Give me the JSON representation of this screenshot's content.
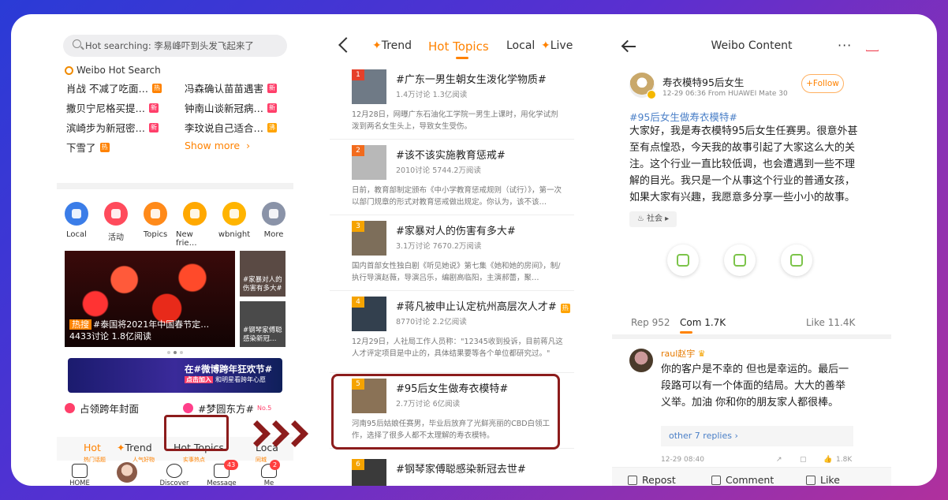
{
  "panel1": {
    "search_placeholder": "Hot searching: 李易峰吓到头发飞起来了",
    "hot_search_title": "Weibo Hot Search",
    "hot_items": [
      {
        "text": "肖战 不减了吃面…",
        "badge": "热"
      },
      {
        "text": "冯森确认苗苗遇害",
        "badge": "新"
      },
      {
        "text": "撒贝宁尼格买提…",
        "badge": "新"
      },
      {
        "text": "钟南山谈新冠病…",
        "badge": "新"
      },
      {
        "text": "滨崎步为新冠密…",
        "badge": "新"
      },
      {
        "text": "李玟说自己适合…",
        "badge": "沸"
      },
      {
        "text": "下雪了",
        "badge": "热"
      }
    ],
    "show_more": "Show more",
    "icons": [
      {
        "label": "Local",
        "color": "#3b7de8"
      },
      {
        "label": "活动",
        "color": "#ff4b5c"
      },
      {
        "label": "Topics",
        "color": "#ff8a1a"
      },
      {
        "label": "New frie…",
        "color": "#ffa800"
      },
      {
        "label": "wbnight",
        "color": "#ffb400"
      },
      {
        "label": "More",
        "color": "#8a93a8"
      }
    ],
    "banner_tag": "热搜",
    "banner_title": "#泰国将2021年中国春节定…",
    "banner_stats": "4433讨论 1.8亿阅读",
    "thumb1": "#家暴对人的伤害有多大#",
    "thumb2": "#钢琴家傅聪感染新冠…",
    "promo_title": "在#微博跨年狂欢节#",
    "promo_join": "点击加入",
    "promo_sub": "和明星看跨年心愿",
    "topic_a": "占领跨年封面",
    "topic_b": "#梦圆东方#",
    "topic_b_rank": "No.5",
    "tabs": [
      {
        "label": "Hot",
        "sub": "热门话题"
      },
      {
        "label": "Trend",
        "sub": "人气好物"
      },
      {
        "label": "Hot Topics",
        "sub": "实事热点"
      },
      {
        "label": "Loca",
        "sub": "同城"
      }
    ],
    "tabbar": [
      {
        "label": "HOME"
      },
      {
        "label": ""
      },
      {
        "label": "Discover"
      },
      {
        "label": "Message",
        "count": "43"
      },
      {
        "label": "Me",
        "count": "2"
      }
    ]
  },
  "panel2": {
    "nav": [
      "Trend",
      "Hot Topics",
      "Local",
      "Live"
    ],
    "topics": [
      {
        "rank": "1",
        "title": "#广东一男生朝女生泼化学物质#",
        "stats": "1.4万讨论 1.3亿阅读",
        "desc": "12月28日，网曝广东石油化工学院一男生上课时，用化学试剂泼到两名女生头上，导致女生受伤。"
      },
      {
        "rank": "2",
        "title": "#该不该实施教育惩戒#",
        "stats": "2010讨论 5744.2万阅读",
        "desc": "日前，教育部制定颁布《中小学教育惩戒规则（试行）》，第一次以部门规章的形式对教育惩戒做出规定。你认为，该不该…"
      },
      {
        "rank": "3",
        "title": "#家暴对人的伤害有多大#",
        "stats": "3.1万讨论 7670.2万阅读",
        "desc": "国内首部女性独白剧《听见她说》第七集《她和她的房间》，制/执行导演赵薇，导演吕乐，编剧高临阳，主演郝蕾，聚…"
      },
      {
        "rank": "4",
        "title": "#蒋凡被申止认定杭州高层次人才#",
        "stats": "8770讨论 2.2亿阅读",
        "desc": "12月29日，人社局工作人员称：\"12345收到投诉，目前蒋凡这人才评定项目是中止的，具体结果要等各个单位都研究过。\"",
        "badge": "热"
      },
      {
        "rank": "5",
        "title": "#95后女生做寿衣模特#",
        "stats": "2.7万讨论 6亿阅读",
        "desc": "河南95后姑娘任赛男，毕业后放弃了光鲜亮丽的CBD白领工作，选择了很多人都不太理解的寿衣模特。"
      },
      {
        "rank": "6",
        "title": "#钢琴家傅聪感染新冠去世#",
        "stats": "",
        "desc": ""
      }
    ]
  },
  "panel3": {
    "title": "Weibo Content",
    "more": "···",
    "poster_name": "寿衣模特95后女生",
    "poster_meta": "12-29 06:36  From HUAWEI Mate 30",
    "follow": "+Follow",
    "hashtag": "#95后女生做寿衣模特#",
    "body": "大家好，我是寿衣模特95后女生任赛男。很意外甚至有点惶恐，今天我的故事引起了大家这么大的关注。这个行业一直比较低调，也会遭遇到一些不理解的目光。我只是一个从事这个行业的普通女孩，如果大家有兴趣，我愿意多分享一些小小的故事。",
    "chip": "社会",
    "stats": {
      "repost": "Rep 952",
      "comment": "Com 1.7K",
      "like": "Like 11.4K"
    },
    "commenter": "raul赵宇",
    "comment": "你的客户是不幸的 但也是幸运的。最后一段路可以有一个体面的结局。大大的善举 义举。加油 你和你的朋友家人都很棒。",
    "replies": "other 7 replies",
    "comment_time": "12-29 08:40",
    "comment_likes": "1.8K",
    "bottom": {
      "repost": "Repost",
      "comment": "Comment",
      "like": "Like"
    }
  }
}
